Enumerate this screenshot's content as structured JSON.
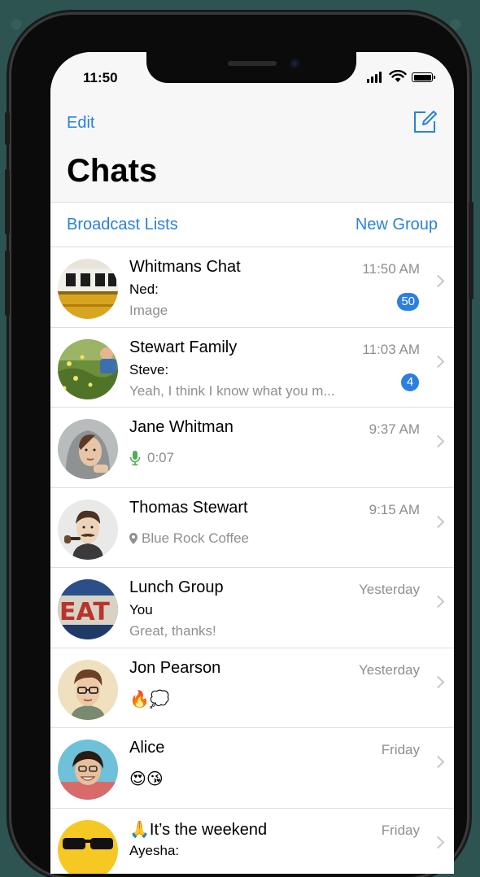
{
  "status": {
    "time": "11:50"
  },
  "header": {
    "edit_label": "Edit",
    "title": "Chats",
    "broadcast_label": "Broadcast Lists",
    "new_group_label": "New Group"
  },
  "chats": [
    {
      "name": "Whitmans Chat",
      "time": "11:50 AM",
      "sender": "Ned:",
      "preview": "Image",
      "badge": "50"
    },
    {
      "name": "Stewart Family",
      "time": "11:03 AM",
      "sender": "Steve:",
      "preview": "Yeah, I think I know what you m...",
      "badge": "4"
    },
    {
      "name": "Jane Whitman",
      "time": "9:37 AM",
      "preview": "0:07",
      "preview_icon": "microphone-icon"
    },
    {
      "name": "Thomas Stewart",
      "time": "9:15 AM",
      "preview": "Blue Rock Coffee",
      "preview_icon": "location-pin-icon"
    },
    {
      "name": "Lunch Group",
      "time": "Yesterday",
      "sender": "You",
      "preview": "Great, thanks!"
    },
    {
      "name": "Jon Pearson",
      "time": "Yesterday",
      "preview": "🔥💭"
    },
    {
      "name": "Alice",
      "time": "Friday",
      "preview": "😍😘"
    },
    {
      "name": "🙏It’s the weekend",
      "time": "Friday",
      "sender": "Ayesha:"
    }
  ],
  "colors": {
    "accent": "#2a82d8",
    "badge": "#2c7fe0",
    "mic": "#4caf50"
  }
}
